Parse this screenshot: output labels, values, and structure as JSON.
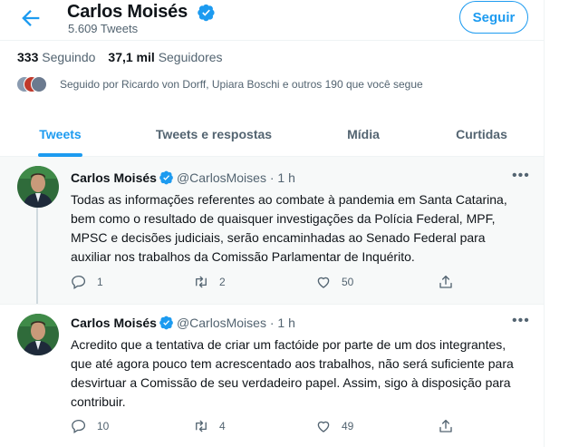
{
  "header": {
    "title": "Carlos Moisés",
    "subtitle": "5.609 Tweets",
    "follow_label": "Seguir",
    "back_icon": "arrow-left-icon",
    "verified_icon": "verified-badge-icon"
  },
  "stats": {
    "following_count": "333",
    "following_label": "Seguindo",
    "followers_count": "37,1 mil",
    "followers_label": "Seguidores",
    "followed_by": "Seguido por Ricardo von Dorff, Upiara Boschi e outros 190 que você segue"
  },
  "tabs": [
    {
      "label": "Tweets",
      "active": true
    },
    {
      "label": "Tweets e respostas",
      "active": false
    },
    {
      "label": "Mídia",
      "active": false
    },
    {
      "label": "Curtidas",
      "active": false
    }
  ],
  "tweets": [
    {
      "name": "Carlos Moisés",
      "handle": "@CarlosMoises",
      "dot": "·",
      "time": "1 h",
      "text": "Todas as informações referentes ao combate à pandemia em Santa Catarina, bem como o resultado de quaisquer investigações da Polícia Federal, MPF, MPSC e decisões judiciais, serão encaminhadas ao Senado Federal para auxiliar nos trabalhos da Comissão Parlamentar de Inquérito.",
      "replies": "1",
      "retweets": "2",
      "likes": "50"
    },
    {
      "name": "Carlos Moisés",
      "handle": "@CarlosMoises",
      "dot": "·",
      "time": "1 h",
      "text": "Acredito que a tentativa de criar um factóide por parte de um dos integrantes, que até agora pouco tem acrescentado aos trabalhos, não será suficiente para desvirtuar a Comissão de seu verdadeiro papel. Assim, sigo à disposição para contribuir.",
      "replies": "10",
      "retweets": "4",
      "likes": "49"
    }
  ],
  "colors": {
    "accent": "#1d9bf0",
    "text_primary": "#0f1419",
    "text_secondary": "#536471",
    "highlight_bg": "#f7f9f9"
  }
}
